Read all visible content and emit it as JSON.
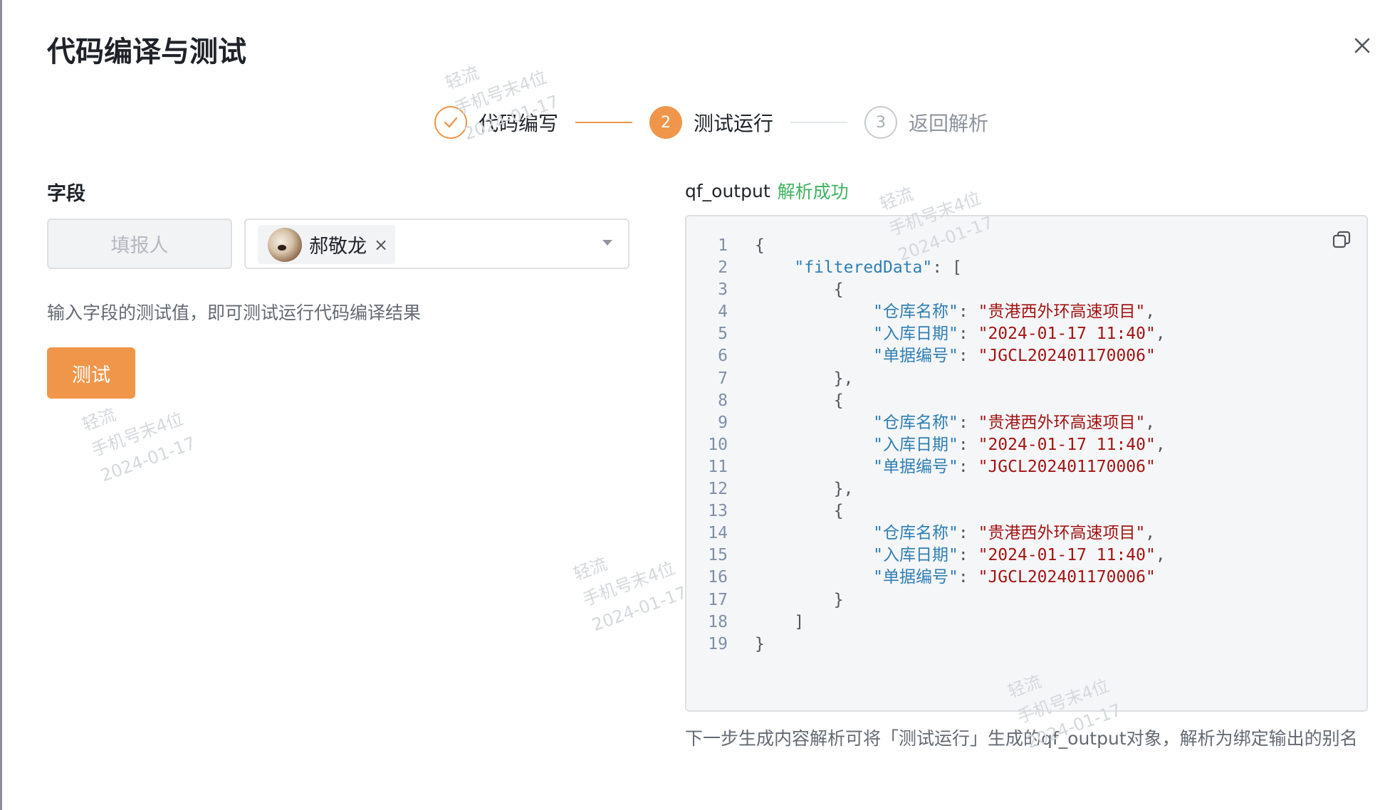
{
  "dialog": {
    "title": "代码编译与测试",
    "close_icon": "close-icon"
  },
  "steps": [
    {
      "index": "1",
      "label": "代码编写",
      "status": "done",
      "icon": "check-icon"
    },
    {
      "index": "2",
      "label": "测试运行",
      "status": "active"
    },
    {
      "index": "3",
      "label": "返回解析",
      "status": "wait"
    }
  ],
  "field_section": {
    "title": "字段",
    "field_name_placeholder": "填报人",
    "selected_member": {
      "name": "郝敬龙",
      "remove_symbol": "×",
      "avatar": "avatar-photo"
    },
    "dropdown_icon": "caret-down-icon",
    "hint": "输入字段的测试值，即可测试运行代码编译结果",
    "test_button_label": "测试"
  },
  "output": {
    "name": "qf_output",
    "status": "解析成功",
    "copy_icon": "copy-icon",
    "line_numbers": [
      "1",
      "2",
      "3",
      "4",
      "5",
      "6",
      "7",
      "8",
      "9",
      "10",
      "11",
      "12",
      "13",
      "14",
      "15",
      "16",
      "17",
      "18",
      "19"
    ],
    "code_lines": [
      "{",
      "    \"filteredData\": [",
      "        {",
      "            \"仓库名称\": \"贵港西外环高速项目\",",
      "            \"入库日期\": \"2024-01-17 11:40\",",
      "            \"单据编号\": \"JGCL202401170006\"",
      "        },",
      "        {",
      "            \"仓库名称\": \"贵港西外环高速项目\",",
      "            \"入库日期\": \"2024-01-17 11:40\",",
      "            \"单据编号\": \"JGCL202401170006\"",
      "        },",
      "        {",
      "            \"仓库名称\": \"贵港西外环高速项目\",",
      "            \"入库日期\": \"2024-01-17 11:40\",",
      "            \"单据编号\": \"JGCL202401170006\"",
      "        }",
      "    ]",
      "}"
    ],
    "footer_hint": "下一步生成内容解析可将「测试运行」生成的qf_output对象，解析为绑定输出的别名"
  },
  "watermark": {
    "line1": "轻流",
    "line2": "手机号末4位",
    "line3": "2024-01-17"
  },
  "colors": {
    "accent": "#f0964a",
    "success": "#3fb35f",
    "code_key": "#2f7fb5",
    "code_string": "#a31515",
    "line_number": "#7e8fa8"
  }
}
